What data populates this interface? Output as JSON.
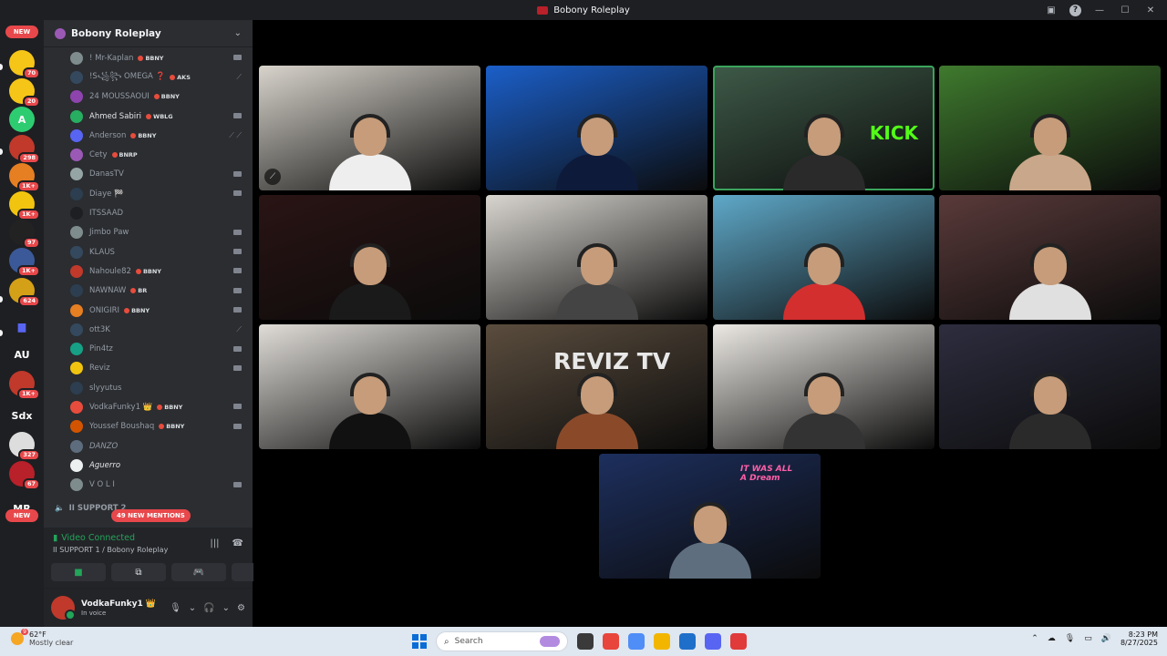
{
  "window": {
    "title": "Bobony Roleplay"
  },
  "rail": {
    "items": [
      {
        "type": "pill",
        "label": "NEW"
      },
      {
        "type": "server",
        "color": "#f5c518",
        "glyph": "",
        "badge": "70"
      },
      {
        "type": "server",
        "color": "#f5c518",
        "glyph": "",
        "badge": "20"
      },
      {
        "type": "server",
        "color": "#2ecc71",
        "glyph": "A",
        "badge": ""
      },
      {
        "type": "server",
        "color": "#c0392b",
        "glyph": "",
        "badge": "298"
      },
      {
        "type": "server",
        "color": "#e67e22",
        "glyph": "",
        "badge": "1K+"
      },
      {
        "type": "server",
        "color": "#f1c40f",
        "glyph": "",
        "badge": "1K+"
      },
      {
        "type": "server",
        "color": "#222222",
        "glyph": "",
        "badge": "97"
      },
      {
        "type": "server",
        "color": "#3b5998",
        "glyph": "",
        "badge": "1K+"
      },
      {
        "type": "server",
        "color": "#d4a017",
        "glyph": "",
        "badge": "624"
      },
      {
        "type": "folder",
        "color": "#1e1f22",
        "glyph": "▆",
        "badge": ""
      },
      {
        "type": "text",
        "color": "#1e1f22",
        "glyph": "AU",
        "badge": ""
      },
      {
        "type": "server",
        "color": "#c0392b",
        "glyph": "",
        "badge": "1K+"
      },
      {
        "type": "text",
        "color": "#1e1f22",
        "glyph": "Sdx",
        "badge": ""
      },
      {
        "type": "server",
        "color": "#dddddd",
        "glyph": "",
        "badge": "327"
      },
      {
        "type": "server",
        "color": "#b8202a",
        "glyph": "",
        "badge": "67"
      },
      {
        "type": "text",
        "color": "#1e1f22",
        "glyph": "MR",
        "badge": ""
      },
      {
        "type": "pill",
        "label": "NEW"
      }
    ]
  },
  "sidebar": {
    "server_name": "Bobony Roleplay",
    "members": [
      {
        "name": "! Mr-Kaplan",
        "tag": "BBNY",
        "status": "cam",
        "color": "#7f8c8d",
        "bright": false
      },
      {
        "name": "!S꧁꧂ OMEGA ❓",
        "tag": "AKS",
        "status": "mute",
        "color": "#34495e",
        "bright": false
      },
      {
        "name": "24 MOUSSAOUI",
        "tag": "BBNY",
        "status": "",
        "color": "#8e44ad",
        "bright": false
      },
      {
        "name": "Ahmed Sabiri",
        "tag": "WBLG",
        "status": "cam",
        "color": "#27ae60",
        "bright": true
      },
      {
        "name": "Anderson",
        "tag": "BBNY",
        "status": "mute2",
        "color": "#5865f2",
        "bright": false
      },
      {
        "name": "Cety",
        "tag": "BNRP",
        "status": "",
        "color": "#9b59b6",
        "bright": false
      },
      {
        "name": "DanasTV",
        "tag": "",
        "status": "cam",
        "color": "#95a5a6",
        "bright": false
      },
      {
        "name": "Diaye 🏁",
        "tag": "",
        "status": "cam",
        "color": "#2c3e50",
        "bright": false
      },
      {
        "name": "ITSSAAD",
        "tag": "",
        "status": "",
        "color": "#1e1f22",
        "bright": false
      },
      {
        "name": "Jimbo Paw",
        "tag": "",
        "status": "cam",
        "color": "#7f8c8d",
        "bright": false
      },
      {
        "name": "KLAUS",
        "tag": "",
        "status": "cam",
        "color": "#34495e",
        "bright": false
      },
      {
        "name": "Nahoule82",
        "tag": "BBNY",
        "status": "cam",
        "color": "#c0392b",
        "bright": false
      },
      {
        "name": "NAWNAW",
        "tag": "BR",
        "status": "cam",
        "color": "#2c3e50",
        "bright": false
      },
      {
        "name": "ONIGIRI",
        "tag": "BBNY",
        "status": "cam",
        "color": "#e67e22",
        "bright": false
      },
      {
        "name": "ott3K",
        "tag": "",
        "status": "mute",
        "color": "#34495e",
        "bright": false
      },
      {
        "name": "Pin4tz",
        "tag": "",
        "status": "cam",
        "color": "#16a085",
        "bright": false
      },
      {
        "name": "Reviz",
        "tag": "",
        "status": "cam",
        "color": "#f1c40f",
        "bright": false
      },
      {
        "name": "slyyutus",
        "tag": "",
        "status": "",
        "color": "#2c3e50",
        "bright": false
      },
      {
        "name": "VodkaFunky1 👑",
        "tag": "BBNY",
        "status": "cam",
        "color": "#e74c3c",
        "bright": false
      },
      {
        "name": "Youssef Boushaq",
        "tag": "BBNY",
        "status": "cam",
        "color": "#d35400",
        "bright": false
      },
      {
        "name": "DANZO",
        "tag": "",
        "status": "",
        "color": "#5d6d7e",
        "bright": false,
        "italic": true
      },
      {
        "name": "Aguerro",
        "tag": "",
        "status": "",
        "color": "#ecf0f1",
        "bright": true,
        "italic": true
      },
      {
        "name": "V O L I",
        "tag": "",
        "status": "cam",
        "color": "#7f8c8d",
        "bright": false
      }
    ],
    "category": "II SUPPORT 2",
    "mentions": "49 NEW MENTIONS"
  },
  "voice": {
    "status": "Video Connected",
    "channel": "II SUPPORT 1 / Bobony Roleplay"
  },
  "user": {
    "name": "VodkaFunky1 👑",
    "status": "In voice"
  },
  "tiles": [
    {
      "bg": "#d8d4cc",
      "body": "#eeeeee",
      "muted": true
    },
    {
      "bg": "#1b5fc9",
      "body": "#0d1a3a",
      "muted": false
    },
    {
      "bg": "#3e5a48",
      "body": "#2a2a2a",
      "muted": false,
      "speaking": true,
      "overlay": "KICK",
      "overlay_color": "#53fc18"
    },
    {
      "bg": "#3f7a2e",
      "body": "#c9a78a",
      "muted": false
    },
    {
      "bg": "#2a1414",
      "body": "#1a1a1a",
      "muted": false
    },
    {
      "bg": "#d9d6d0",
      "body": "#444444",
      "muted": false
    },
    {
      "bg": "#5fa9c9",
      "body": "#d32f2f",
      "muted": false
    },
    {
      "bg": "#5a3a3a",
      "body": "#e0e0e0",
      "muted": false
    },
    {
      "bg": "#e0ddd8",
      "body": "#111111",
      "muted": false
    },
    {
      "bg": "#5b4d3e",
      "body": "#8a4a2a",
      "muted": false,
      "overlay": "REVIZ TV",
      "overlay_color": "#e8e8e8"
    },
    {
      "bg": "#ece9e4",
      "body": "#333333",
      "muted": false
    },
    {
      "bg": "#2d2d3f",
      "body": "#2a2a2a",
      "muted": false
    },
    {
      "bg": "#1d2f5e",
      "body": "#5e6e7e",
      "muted": false,
      "overlay": "IT WAS ALL A Dream",
      "overlay_color": "#ff5fa8"
    }
  ],
  "taskbar": {
    "weather_temp": "62°F",
    "weather_desc": "Mostly clear",
    "weather_badge": "9",
    "search_placeholder": "Search",
    "time": "8:23 PM",
    "date": "8/27/2025",
    "apps": [
      "#3a3a3a",
      "#e8453c",
      "#4f8df7",
      "#f2b600",
      "#1e6fc9",
      "#5865f2",
      "#e03a3a"
    ]
  }
}
